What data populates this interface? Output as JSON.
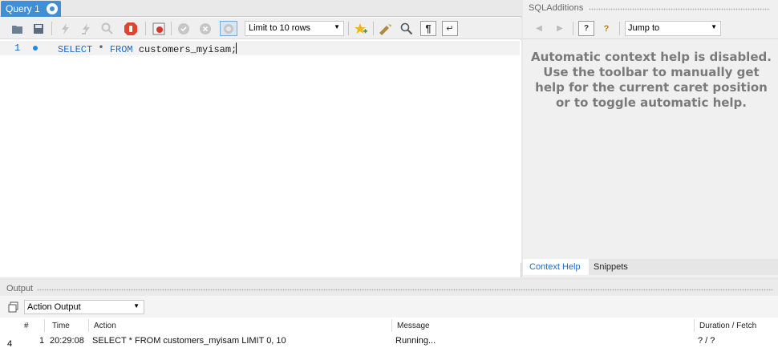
{
  "query_tab": {
    "label": "Query 1"
  },
  "toolbar": {
    "limit_select": "Limit to 10 rows",
    "icons": [
      "open-folder-icon",
      "save-icon",
      "execute-icon",
      "execute-current-icon",
      "explain-icon",
      "stop-icon",
      "toggle-error-icon",
      "commit-icon",
      "rollback-icon",
      "autocommit-icon",
      "add-snippet-icon",
      "beautify-icon",
      "find-icon",
      "invisible-chars-icon",
      "wrap-icon"
    ]
  },
  "editor": {
    "line_number": "1",
    "code": {
      "kw1": "SELECT",
      "star": " * ",
      "kw2": "FROM",
      "rest": " customers_myisam;"
    }
  },
  "sql_additions": {
    "title": "SQLAdditions",
    "jump_select": "Jump to",
    "help_text": "Automatic context help is disabled. Use the toolbar to manually get help for the current caret position or to toggle automatic help.",
    "tabs": {
      "context_help": "Context Help",
      "snippets": "Snippets"
    }
  },
  "output": {
    "title": "Output",
    "select": "Action Output",
    "columns": {
      "num": "#",
      "time": "Time",
      "action": "Action",
      "message": "Message",
      "duration": "Duration / Fetch"
    },
    "rows": [
      {
        "index": "4",
        "num": "1",
        "time": "20:29:08",
        "action": "SELECT * FROM customers_myisam LIMIT 0, 10",
        "message": "Running...",
        "duration": "? / ?"
      }
    ]
  },
  "colors": {
    "accent": "#3f8ed6",
    "keyword": "#1e6bc6",
    "help_text": "#7a7a7a"
  }
}
